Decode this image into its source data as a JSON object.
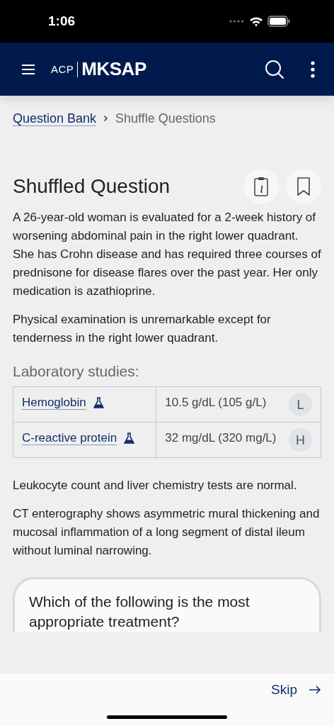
{
  "status_bar": {
    "time": "1:06"
  },
  "header": {
    "logo_prefix": "ACP",
    "logo": "MKSAP"
  },
  "breadcrumb": [
    {
      "label": "Question Bank",
      "kind": "link"
    },
    {
      "label": "Shuffle Questions",
      "kind": "current"
    }
  ],
  "title": "Shuffled Question",
  "paragraphs": [
    "A 26-year-old woman is evaluated for a 2-week history of worsening abdominal pain in the right lower quadrant. She has Crohn disease and has required three courses of prednisone for disease flares over the past year. Her only medication is azathioprine.",
    "Physical examination is unremarkable except for tenderness in the right lower quadrant."
  ],
  "lab_heading": "Laboratory studies:",
  "labs": [
    {
      "name": "Hemoglobin",
      "value": "10.5 g/dL (105 g/L)",
      "flag": "L"
    },
    {
      "name": "C-reactive protein",
      "value": "32 mg/dL (320 mg/L)",
      "flag": "H"
    }
  ],
  "after_paragraphs": [
    "Leukocyte count and liver chemistry tests are normal.",
    "CT enterography shows asymmetric mural thickening and mucosal inflammation of a long segment of distal ileum without luminal narrowing."
  ],
  "question": "Which of the following is the most appropriate treatment?",
  "footer": {
    "skip": "Skip"
  }
}
